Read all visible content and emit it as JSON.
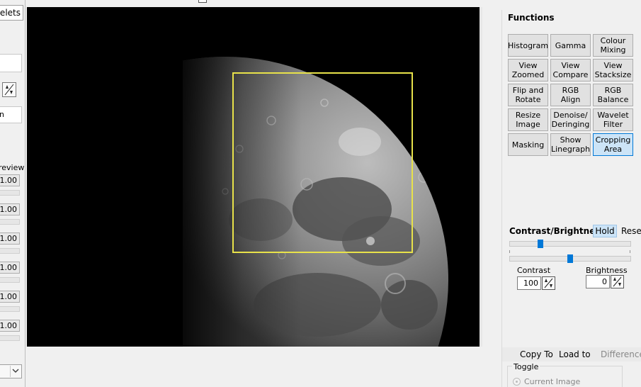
{
  "left_panel": {
    "tab_label": "velets",
    "label_n": "n",
    "label_preview": "review",
    "values": [
      "1.00",
      "1.00",
      "1.00",
      "1.00",
      "1.00",
      "1.00"
    ]
  },
  "functions": {
    "title": "Functions",
    "buttons": [
      {
        "label": "Histogram"
      },
      {
        "label": "Gamma"
      },
      {
        "label": "Colour Mixing"
      },
      {
        "label": "View Zoomed"
      },
      {
        "label": "View Compare"
      },
      {
        "label": "View Stacksize"
      },
      {
        "label": "Flip and Rotate"
      },
      {
        "label": "RGB Align"
      },
      {
        "label": "RGB Balance"
      },
      {
        "label": "Resize Image"
      },
      {
        "label": "Denoise/ Deringing"
      },
      {
        "label": "Wavelet Filter"
      },
      {
        "label": "Masking"
      },
      {
        "label": "Show Linegraph"
      },
      {
        "label": "Cropping Area"
      }
    ]
  },
  "contrast_brightness": {
    "title": "Contrast/Brightness",
    "hold_label": "Hold",
    "reset_label": "Reset",
    "contrast_label": "Contrast",
    "contrast_value": "100",
    "brightness_label": "Brightness",
    "brightness_value": "0"
  },
  "bottom": {
    "copy_to_label": "Copy To",
    "load_to_label": "Load to",
    "difference_label": "Difference",
    "toggle_label": "Toggle",
    "current_image_label": "Current Image"
  },
  "colors": {
    "crop_outline": "#e8e24a",
    "active_button": "#cce4f7",
    "accent": "#0078d7"
  }
}
